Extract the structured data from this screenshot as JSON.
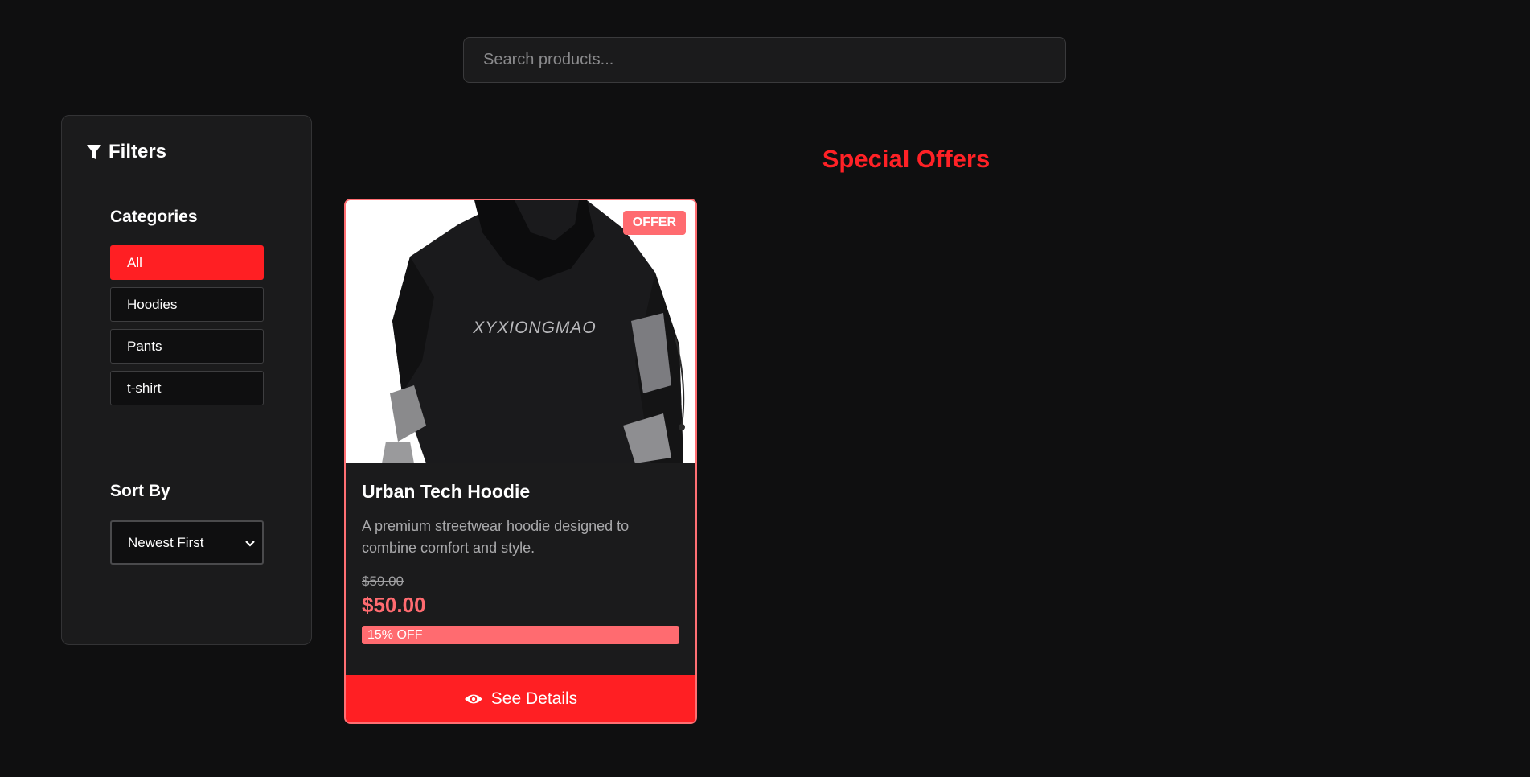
{
  "search": {
    "placeholder": "Search products..."
  },
  "filters": {
    "title": "Filters",
    "categories_label": "Categories",
    "categories": [
      {
        "label": "All",
        "active": true
      },
      {
        "label": "Hoodies",
        "active": false
      },
      {
        "label": "Pants",
        "active": false
      },
      {
        "label": "t-shirt",
        "active": false
      }
    ],
    "sort_label": "Sort By",
    "sort_selected": "Newest First"
  },
  "section": {
    "title": "Special Offers"
  },
  "product": {
    "badge": "OFFER",
    "image_text": "XYXIONGMAO",
    "title": "Urban Tech Hoodie",
    "description": "A premium streetwear hoodie designed to combine comfort and style.",
    "old_price": "$59.00",
    "new_price": "$50.00",
    "discount": "15% OFF",
    "button_label": "See Details"
  },
  "colors": {
    "accent": "#ff1f23",
    "offer": "#ff6b70",
    "background": "#0f0f10",
    "panel": "#1b1b1c"
  },
  "icons": [
    "filter-icon",
    "chevron-down-icon",
    "eye-icon"
  ]
}
